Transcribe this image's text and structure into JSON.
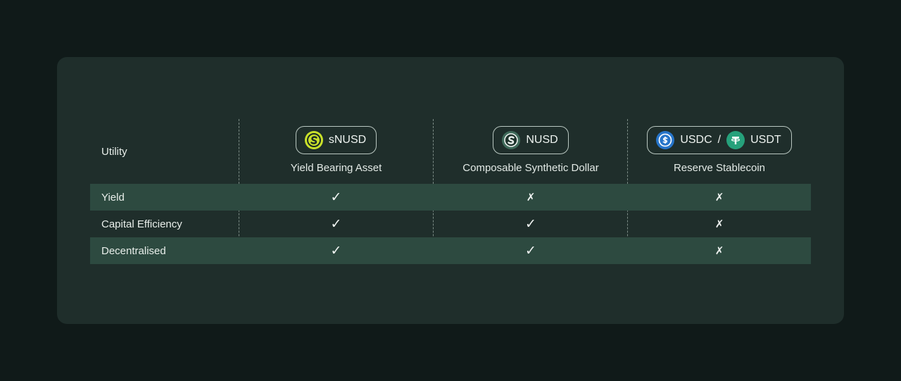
{
  "table": {
    "utility_label": "Utility",
    "columns": [
      {
        "tokens": [
          "sNUSD"
        ],
        "separator": "",
        "subtitle": "Yield Bearing Asset",
        "icons": [
          "snusd-icon"
        ]
      },
      {
        "tokens": [
          "NUSD"
        ],
        "separator": "",
        "subtitle": "Composable Synthetic Dollar",
        "icons": [
          "nusd-icon"
        ]
      },
      {
        "tokens": [
          "USDC",
          "USDT"
        ],
        "separator": "/",
        "subtitle": "Reserve Stablecoin",
        "icons": [
          "usdc-icon",
          "usdt-icon"
        ]
      }
    ],
    "rows": [
      {
        "label": "Yield",
        "values": [
          "✓",
          "✗",
          "✗"
        ]
      },
      {
        "label": "Capital Efficiency",
        "values": [
          "✓",
          "✓",
          "✗"
        ]
      },
      {
        "label": "Decentralised",
        "values": [
          "✓",
          "✓",
          "✗"
        ]
      }
    ]
  },
  "colors": {
    "background": "#101a19",
    "card": "#1f2e2b",
    "shaded_row": "#2d4a40",
    "snusd_coin": "#c9e02a",
    "nusd_coin": "#3f6a5a",
    "usdc_coin": "#2775ca",
    "usdt_coin": "#26a17b"
  }
}
